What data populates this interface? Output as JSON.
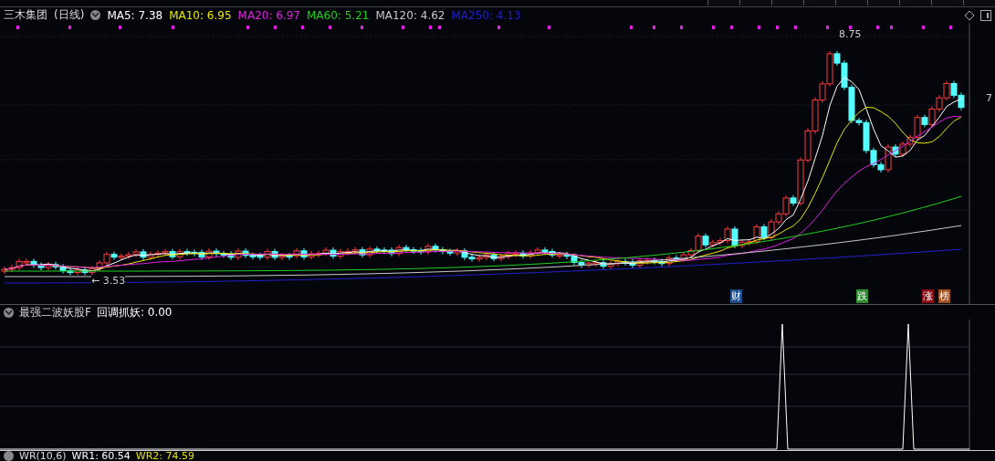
{
  "title": {
    "name": "三木集团",
    "period": "(日线)"
  },
  "ma": [
    {
      "label": "MA5: 7.38",
      "color": "#ffffff"
    },
    {
      "label": "MA10: 6.95",
      "color": "#e8e800"
    },
    {
      "label": "MA20: 6.97",
      "color": "#e020e0"
    },
    {
      "label": "MA60: 5.21",
      "color": "#20d020"
    },
    {
      "label": "MA120: 4.62",
      "color": "#c8c8c8"
    },
    {
      "label": "MA250: 4.13",
      "color": "#2020c8"
    }
  ],
  "price_labels": {
    "high": "8.75",
    "low": "← 3.53"
  },
  "axis_label": "7",
  "events": [
    {
      "label": "财",
      "color": "#1f4e8c"
    },
    {
      "label": "跌",
      "color": "#2e8b2e"
    },
    {
      "label": "涨",
      "color": "#8b0a14"
    },
    {
      "label": "榜",
      "color": "#a0501e"
    }
  ],
  "indicator": {
    "name": "最强二波妖股F",
    "reading": "回调抓妖: 0.00"
  },
  "wr": {
    "name": "WR(10,6)",
    "items": [
      {
        "label": "WR1: 60.54",
        "color": "#ffffff"
      },
      {
        "label": "WR2: 74.59",
        "color": "#e0e000"
      }
    ]
  }
}
